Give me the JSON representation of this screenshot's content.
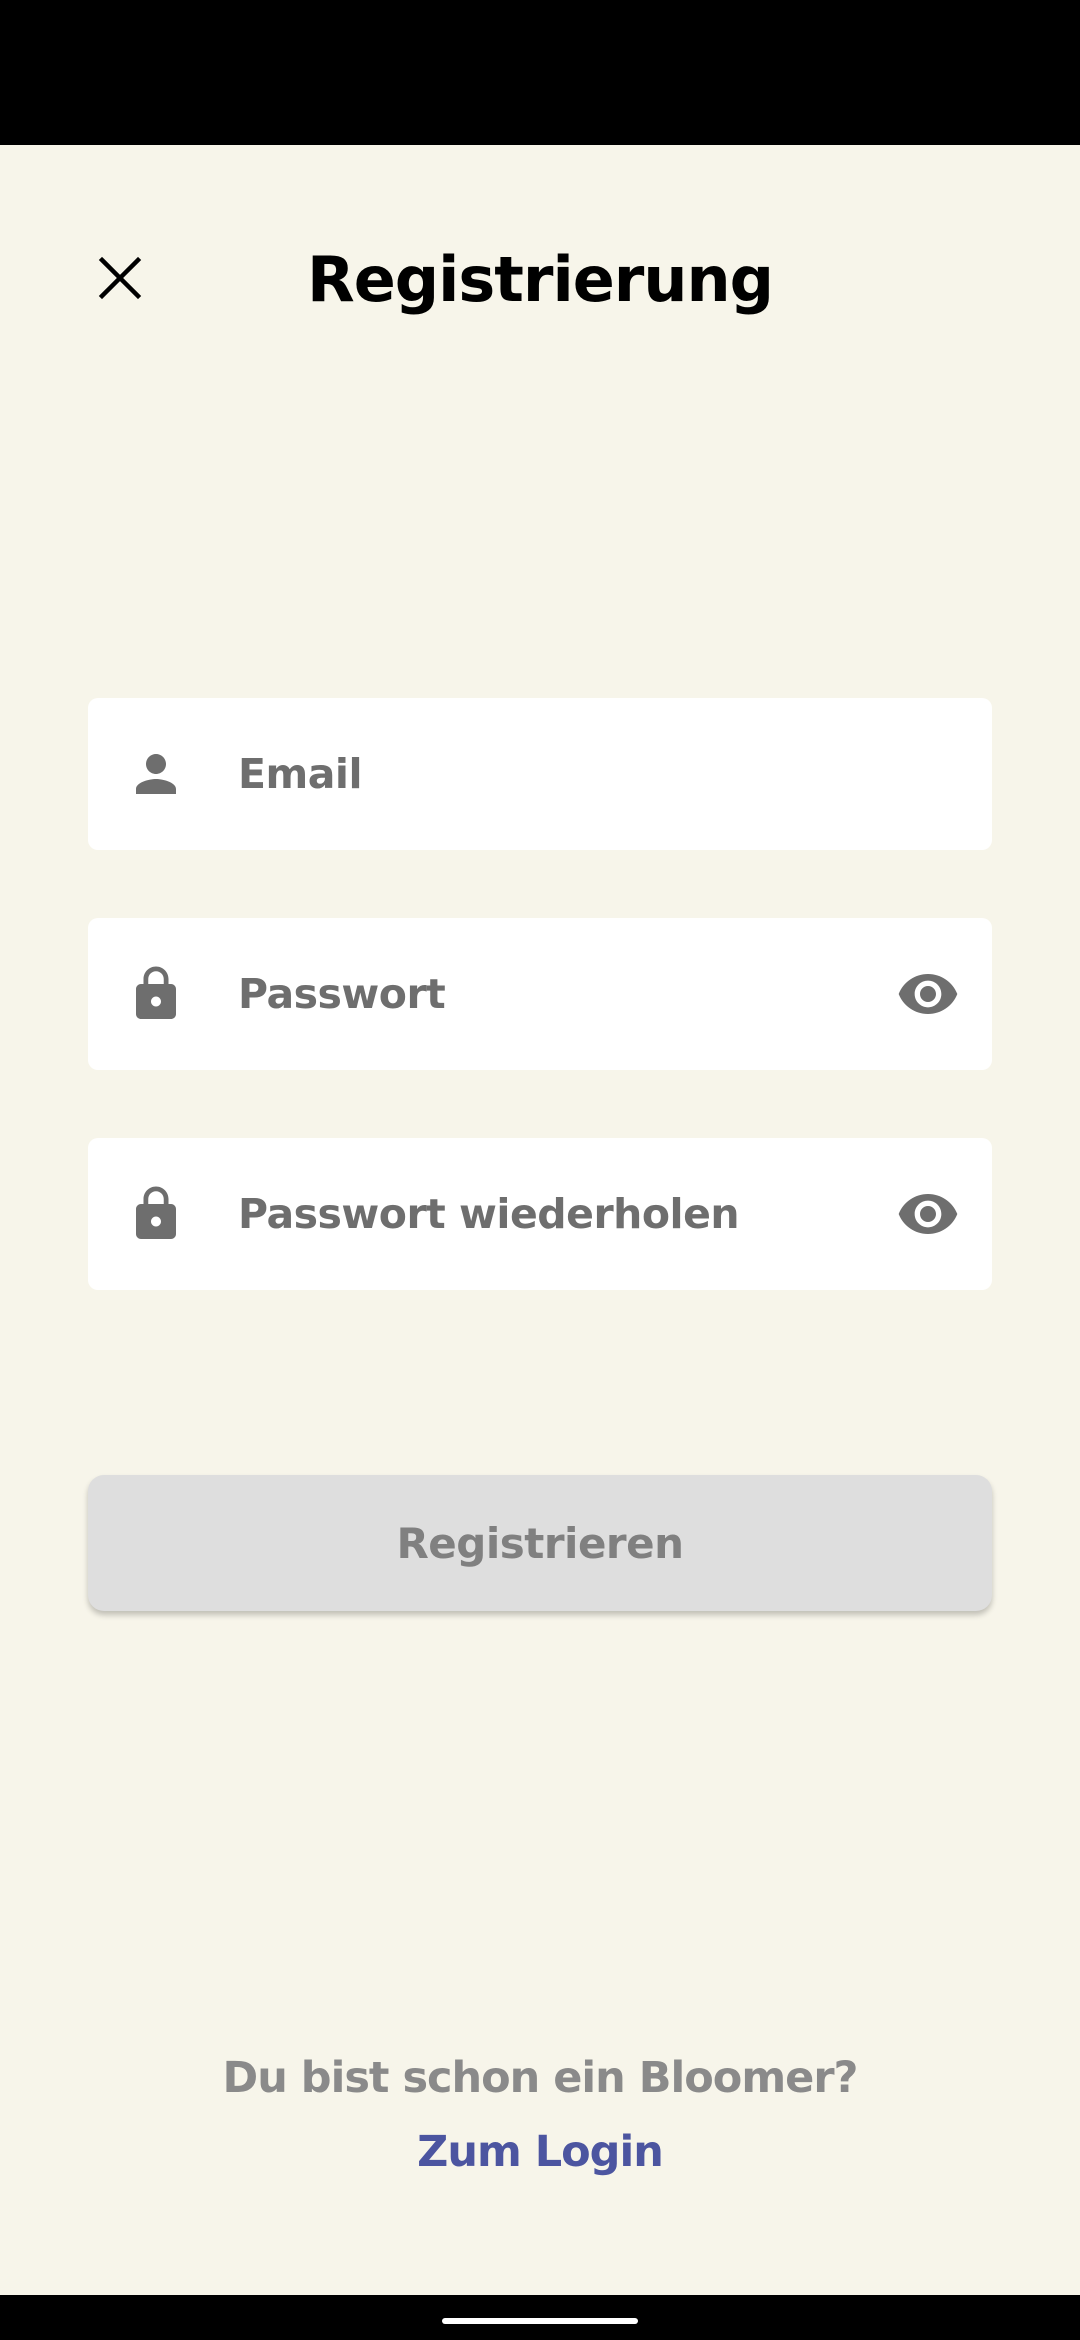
{
  "header": {
    "title": "Registrierung",
    "close_icon": "close-icon"
  },
  "form": {
    "email": {
      "placeholder": "Email",
      "icon": "person-icon"
    },
    "password": {
      "placeholder": "Passwort",
      "icon": "lock-icon",
      "toggle_icon": "eye-icon"
    },
    "password_repeat": {
      "placeholder": "Passwort wiederholen",
      "icon": "lock-icon",
      "toggle_icon": "eye-icon"
    },
    "submit_label": "Registrieren"
  },
  "footer": {
    "prompt": "Du bist schon ein Bloomer?",
    "login_link": "Zum Login"
  },
  "colors": {
    "background": "#f7f5ea",
    "link": "#4c55a0",
    "icon": "#6e6e6e",
    "button_disabled": "#dedede"
  }
}
